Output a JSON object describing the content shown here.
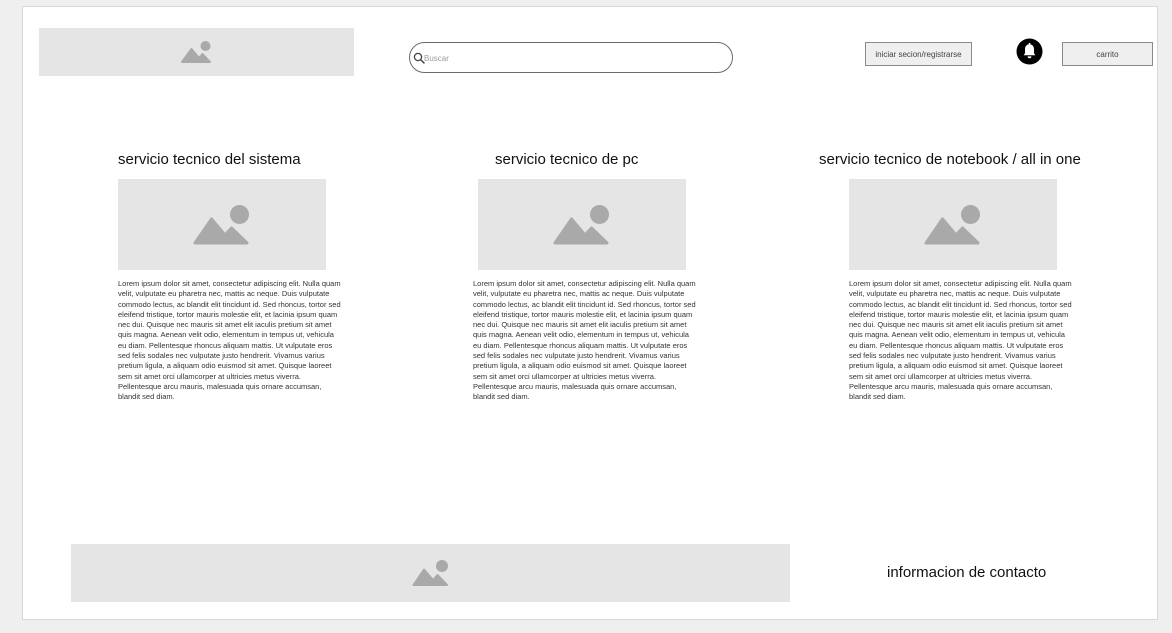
{
  "header": {
    "logo_icon": "image-placeholder-icon",
    "search": {
      "placeholder": "Buscar",
      "value": "",
      "icon": "search-icon"
    },
    "login_label": "iniciar secion/registrarse",
    "notification_icon": "bell-icon",
    "cart_label": "carrito"
  },
  "services": [
    {
      "title": "servicio tecnico del sistema",
      "image_icon": "image-placeholder-icon",
      "text": "Lorem ipsum dolor sit amet, consectetur adipiscing elit. Nulla quam velit, vulputate eu pharetra nec, mattis ac neque. Duis vulputate commodo lectus, ac blandit elit tincidunt id. Sed rhoncus, tortor sed eleifend tristique, tortor mauris molestie elit, et lacinia ipsum quam nec dui. Quisque nec mauris sit amet elit iaculis pretium sit amet quis magna. Aenean velit odio, elementum in tempus ut, vehicula eu diam. Pellentesque rhoncus aliquam mattis. Ut vulputate eros sed felis sodales nec vulputate justo hendrerit. Vivamus varius pretium ligula, a aliquam odio euismod sit amet. Quisque laoreet sem sit amet orci ullamcorper at ultricies metus viverra. Pellentesque arcu mauris, malesuada quis ornare accumsan, blandit sed diam."
    },
    {
      "title": "servicio tecnico de pc",
      "image_icon": "image-placeholder-icon",
      "text": "Lorem ipsum dolor sit amet, consectetur adipiscing elit. Nulla quam velit, vulputate eu pharetra nec, mattis ac neque. Duis vulputate commodo lectus, ac blandit elit tincidunt id. Sed rhoncus, tortor sed eleifend tristique, tortor mauris molestie elit, et lacinia ipsum quam nec dui. Quisque nec mauris sit amet elit iaculis pretium sit amet quis magna. Aenean velit odio, elementum in tempus ut, vehicula eu diam. Pellentesque rhoncus aliquam mattis. Ut vulputate eros sed felis sodales nec vulputate justo hendrerit. Vivamus varius pretium ligula, a aliquam odio euismod sit amet. Quisque laoreet sem sit amet orci ullamcorper at ultricies metus viverra. Pellentesque arcu mauris, malesuada quis ornare accumsan, blandit sed diam."
    },
    {
      "title": "servicio tecnico de notebook / all in one",
      "image_icon": "image-placeholder-icon",
      "text": "Lorem ipsum dolor sit amet, consectetur adipiscing elit. Nulla quam velit, vulputate eu pharetra nec, mattis ac neque. Duis vulputate commodo lectus, ac blandit elit tincidunt id. Sed rhoncus, tortor sed eleifend tristique, tortor mauris molestie elit, et lacinia ipsum quam nec dui. Quisque nec mauris sit amet elit iaculis pretium sit amet quis magna. Aenean velit odio, elementum in tempus ut, vehicula eu diam. Pellentesque rhoncus aliquam mattis. Ut vulputate eros sed felis sodales nec vulputate justo hendrerit. Vivamus varius pretium ligula, a aliquam odio euismod sit amet. Quisque laoreet sem sit amet orci ullamcorper at ultricies metus viverra. Pellentesque arcu mauris, malesuada quis ornare accumsan, blandit sed diam."
    }
  ],
  "footer": {
    "image_icon": "image-placeholder-icon",
    "contact_label": "informacion de contacto"
  },
  "colors": {
    "placeholder_bg": "#e5e5e5",
    "placeholder_icon": "#a9a9a9",
    "button_bg": "#efefef",
    "page_bg": "#ffffff"
  }
}
